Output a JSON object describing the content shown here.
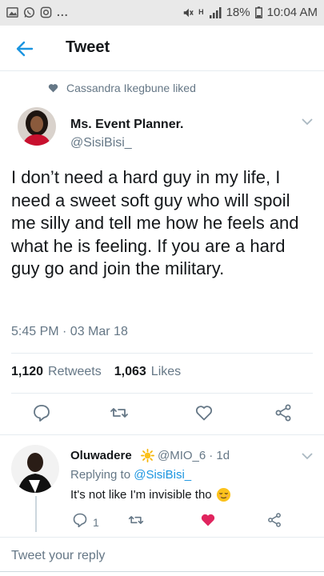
{
  "status_bar": {
    "left_icons": [
      "gallery-icon",
      "whatsapp-icon",
      "instagram-icon"
    ],
    "more": "...",
    "right_indicator": "H",
    "battery": "18%",
    "time": "10:04 AM"
  },
  "header": {
    "title": "Tweet"
  },
  "social_context": {
    "text": "Cassandra Ikegbune liked"
  },
  "tweet": {
    "author_name": "Ms. Event Planner.",
    "author_handle": "@SisiBisi_",
    "text": "I don’t need a hard guy in my life, I need a sweet soft guy who will spoil me silly and tell me how he feels and what he is feeling. If you are a hard guy go and join the military.",
    "timestamp": "5:45 PM · 03 Mar 18",
    "retweets_count": "1,120",
    "retweets_label": "Retweets",
    "likes_count": "1,063",
    "likes_label": "Likes"
  },
  "reply": {
    "author_name": "Oluwadere",
    "handle": "@MIO_6",
    "time": "· 1d",
    "replying_prefix": "Replying to",
    "replying_to": "@SisiBisi_",
    "text": "It's not like I'm invisible tho",
    "reply_count": "1"
  },
  "composer": {
    "placeholder": "Tweet your reply"
  },
  "colors": {
    "accent": "#1b95e0",
    "like": "#e0245e",
    "muted": "#657786",
    "text": "#14171a",
    "statusbar": "#e9e9e9"
  }
}
